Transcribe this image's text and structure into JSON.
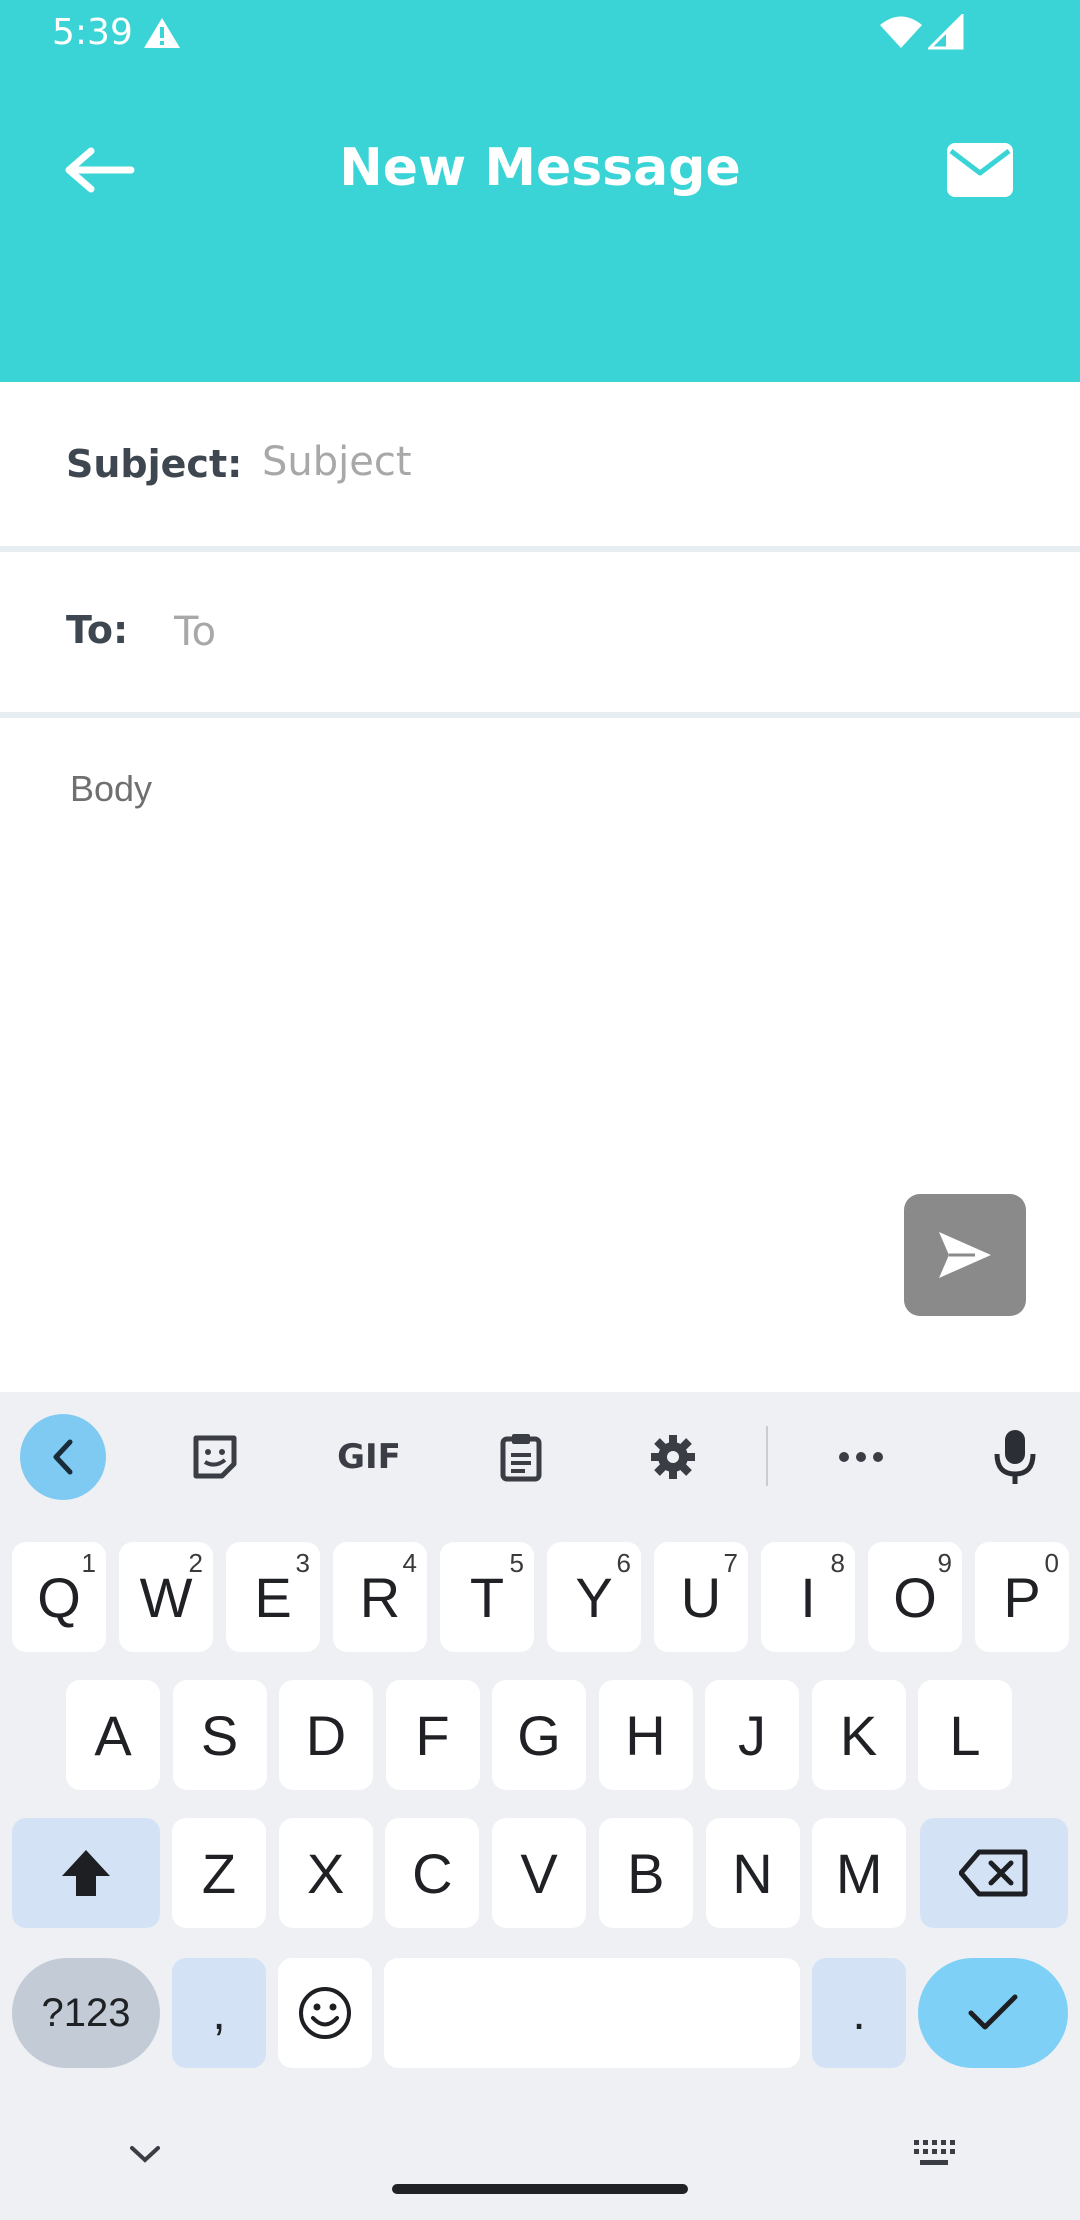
{
  "status_bar": {
    "time": "5:39"
  },
  "header": {
    "title": "New Message",
    "bg_color": "#3bd4d6"
  },
  "form": {
    "subject_label": "Subject:",
    "subject_placeholder": "Subject",
    "to_label": "To:",
    "to_placeholder": "To",
    "body_placeholder": "Body"
  },
  "keyboard": {
    "toolbar": [
      "collapse-icon",
      "sticker-icon",
      "gif-icon",
      "clipboard-icon",
      "gear-icon",
      "more-icon",
      "microphone-icon"
    ],
    "gif_label": "GIF",
    "row1": [
      {
        "key": "Q",
        "hint": "1"
      },
      {
        "key": "W",
        "hint": "2"
      },
      {
        "key": "E",
        "hint": "3"
      },
      {
        "key": "R",
        "hint": "4"
      },
      {
        "key": "T",
        "hint": "5"
      },
      {
        "key": "Y",
        "hint": "6"
      },
      {
        "key": "U",
        "hint": "7"
      },
      {
        "key": "I",
        "hint": "8"
      },
      {
        "key": "O",
        "hint": "9"
      },
      {
        "key": "P",
        "hint": "0"
      }
    ],
    "row2": [
      "A",
      "S",
      "D",
      "F",
      "G",
      "H",
      "J",
      "K",
      "L"
    ],
    "row3": [
      "Z",
      "X",
      "C",
      "V",
      "B",
      "N",
      "M"
    ],
    "symbols_label": "?123",
    "comma": ",",
    "period": "."
  }
}
